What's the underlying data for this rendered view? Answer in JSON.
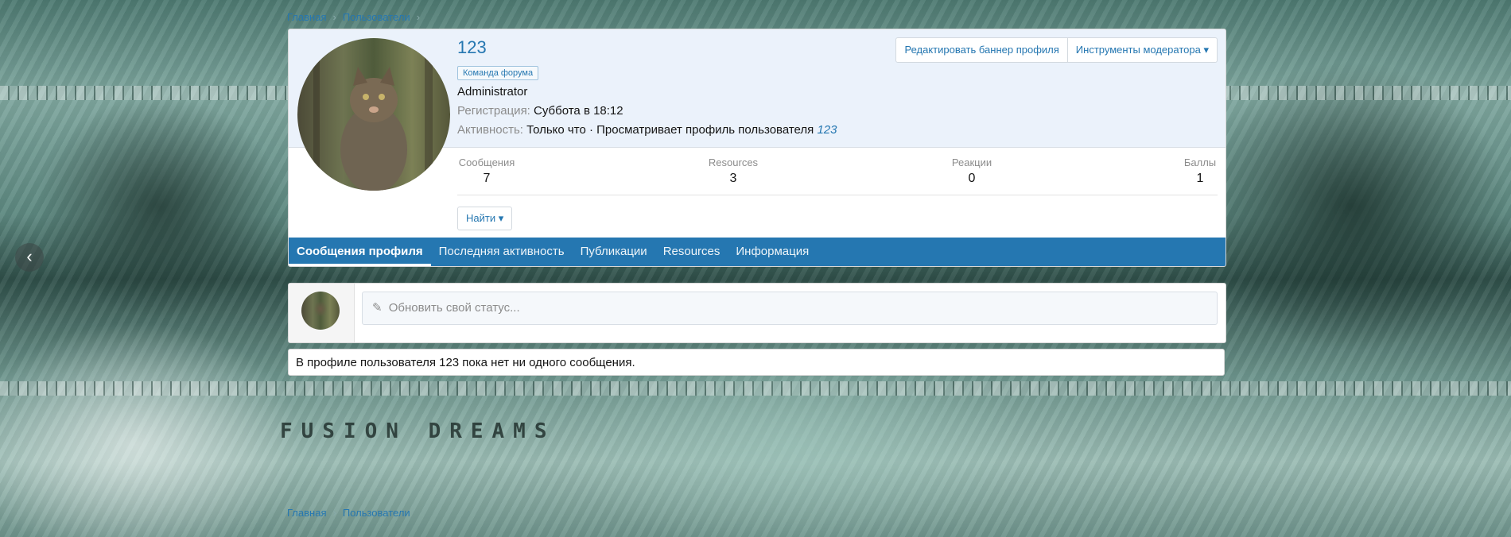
{
  "breadcrumb": {
    "home": "Главная",
    "users": "Пользователи"
  },
  "banner": {
    "text": "FUSION DREAMS"
  },
  "nav": {
    "prev_icon": "chevron-left-icon"
  },
  "profile": {
    "username": "123",
    "badge": "Команда форума",
    "role": "Administrator",
    "registration_label": "Регистрация:",
    "registration_value": "Суббота в 18:12",
    "activity_label": "Активность:",
    "activity_value": "Только что · Просматривает профиль пользователя",
    "activity_link": "123",
    "edit_banner_button": "Редактировать баннер профиля",
    "moderator_tools_button": "Инструменты модератора"
  },
  "stats": [
    {
      "label": "Сообщения",
      "value": "7"
    },
    {
      "label": "Resources",
      "value": "3"
    },
    {
      "label": "Реакции",
      "value": "0"
    },
    {
      "label": "Баллы",
      "value": "1"
    }
  ],
  "find_button": "Найти",
  "tabs": [
    {
      "label": "Сообщения профиля",
      "active": true
    },
    {
      "label": "Последняя активность",
      "active": false
    },
    {
      "label": "Публикации",
      "active": false
    },
    {
      "label": "Resources",
      "active": false
    },
    {
      "label": "Информация",
      "active": false
    }
  ],
  "status": {
    "placeholder": "Обновить свой статус..."
  },
  "empty_message": "В профиле пользователя 123 пока нет ни одного сообщения.",
  "colors": {
    "accent": "#2577b1",
    "header_bg": "#ebf2fb"
  }
}
